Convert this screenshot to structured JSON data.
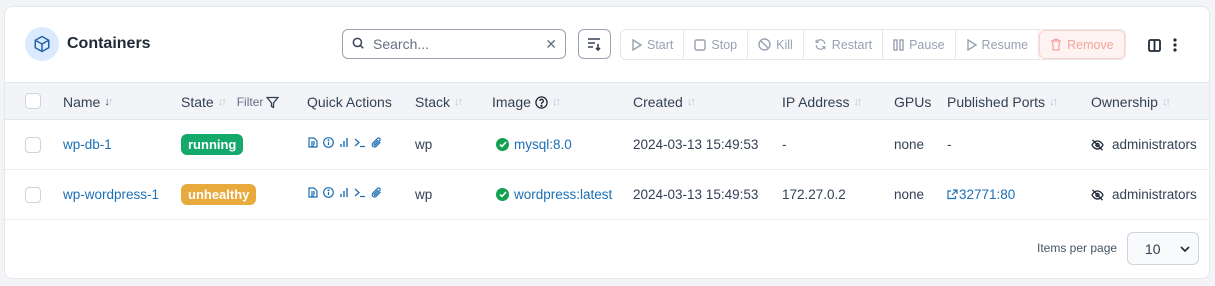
{
  "header": {
    "title": "Containers",
    "search_placeholder": "Search...",
    "actions": [
      {
        "label": "Start",
        "icon": "play-icon"
      },
      {
        "label": "Stop",
        "icon": "stop-icon"
      },
      {
        "label": "Kill",
        "icon": "ban-icon"
      },
      {
        "label": "Restart",
        "icon": "refresh-icon"
      },
      {
        "label": "Pause",
        "icon": "pause-icon"
      },
      {
        "label": "Resume",
        "icon": "play-icon"
      },
      {
        "label": "Remove",
        "icon": "trash-icon"
      }
    ]
  },
  "table": {
    "columns": {
      "name": "Name",
      "state": "State",
      "filter": "Filter",
      "quick_actions": "Quick Actions",
      "stack": "Stack",
      "image": "Image",
      "created": "Created",
      "ip": "IP Address",
      "gpus": "GPUs",
      "ports": "Published Ports",
      "ownership": "Ownership"
    },
    "rows": [
      {
        "name": "wp-db-1",
        "state": "running",
        "stack": "wp",
        "image": "mysql:8.0",
        "created": "2024-03-13 15:49:53",
        "ip": "-",
        "gpus": "none",
        "ports": "-",
        "ownership": "administrators"
      },
      {
        "name": "wp-wordpress-1",
        "state": "unhealthy",
        "stack": "wp",
        "image": "wordpress:latest",
        "created": "2024-03-13 15:49:53",
        "ip": "172.27.0.2",
        "gpus": "none",
        "ports": "32771:80",
        "ownership": "administrators"
      }
    ]
  },
  "footer": {
    "items_per_page_label": "Items per page",
    "items_per_page_value": "10"
  },
  "colors": {
    "link": "#1c6fb5",
    "running": "#14a86a",
    "unhealthy": "#e8a93d",
    "remove": "#f3a59c"
  }
}
